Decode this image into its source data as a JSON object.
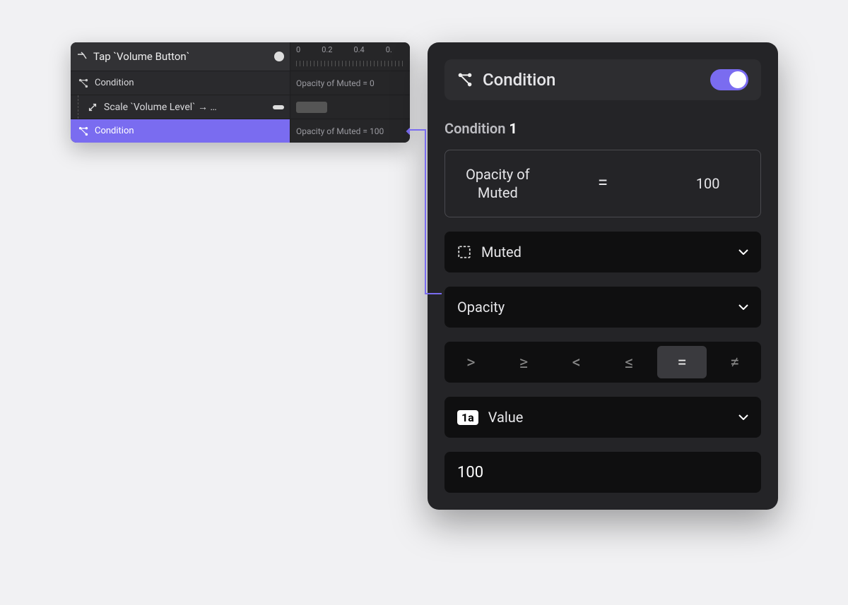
{
  "timeline": {
    "header_label": "Tap `Volume Button`",
    "ruler_labels": [
      "0",
      "0.2",
      "0.4",
      "0."
    ],
    "rows": [
      {
        "label": "Condition",
        "right_text": "Opacity of Muted = 0"
      },
      {
        "label": "Scale `Volume Level` → …",
        "right_text": ""
      },
      {
        "label": "Condition",
        "right_text": "Opacity of Muted = 100"
      }
    ]
  },
  "detail": {
    "header_title": "Condition",
    "section_label": "Condition",
    "section_num": "1",
    "expr_property": "Opacity of Muted",
    "expr_operator": "=",
    "expr_value": "100",
    "dd_layer": "Muted",
    "dd_property": "Opacity",
    "operators": [
      ">",
      "≥",
      "<",
      "≤",
      "=",
      "≠"
    ],
    "value_type_label": "Value",
    "value_badge": "1a",
    "value_input": "100"
  }
}
